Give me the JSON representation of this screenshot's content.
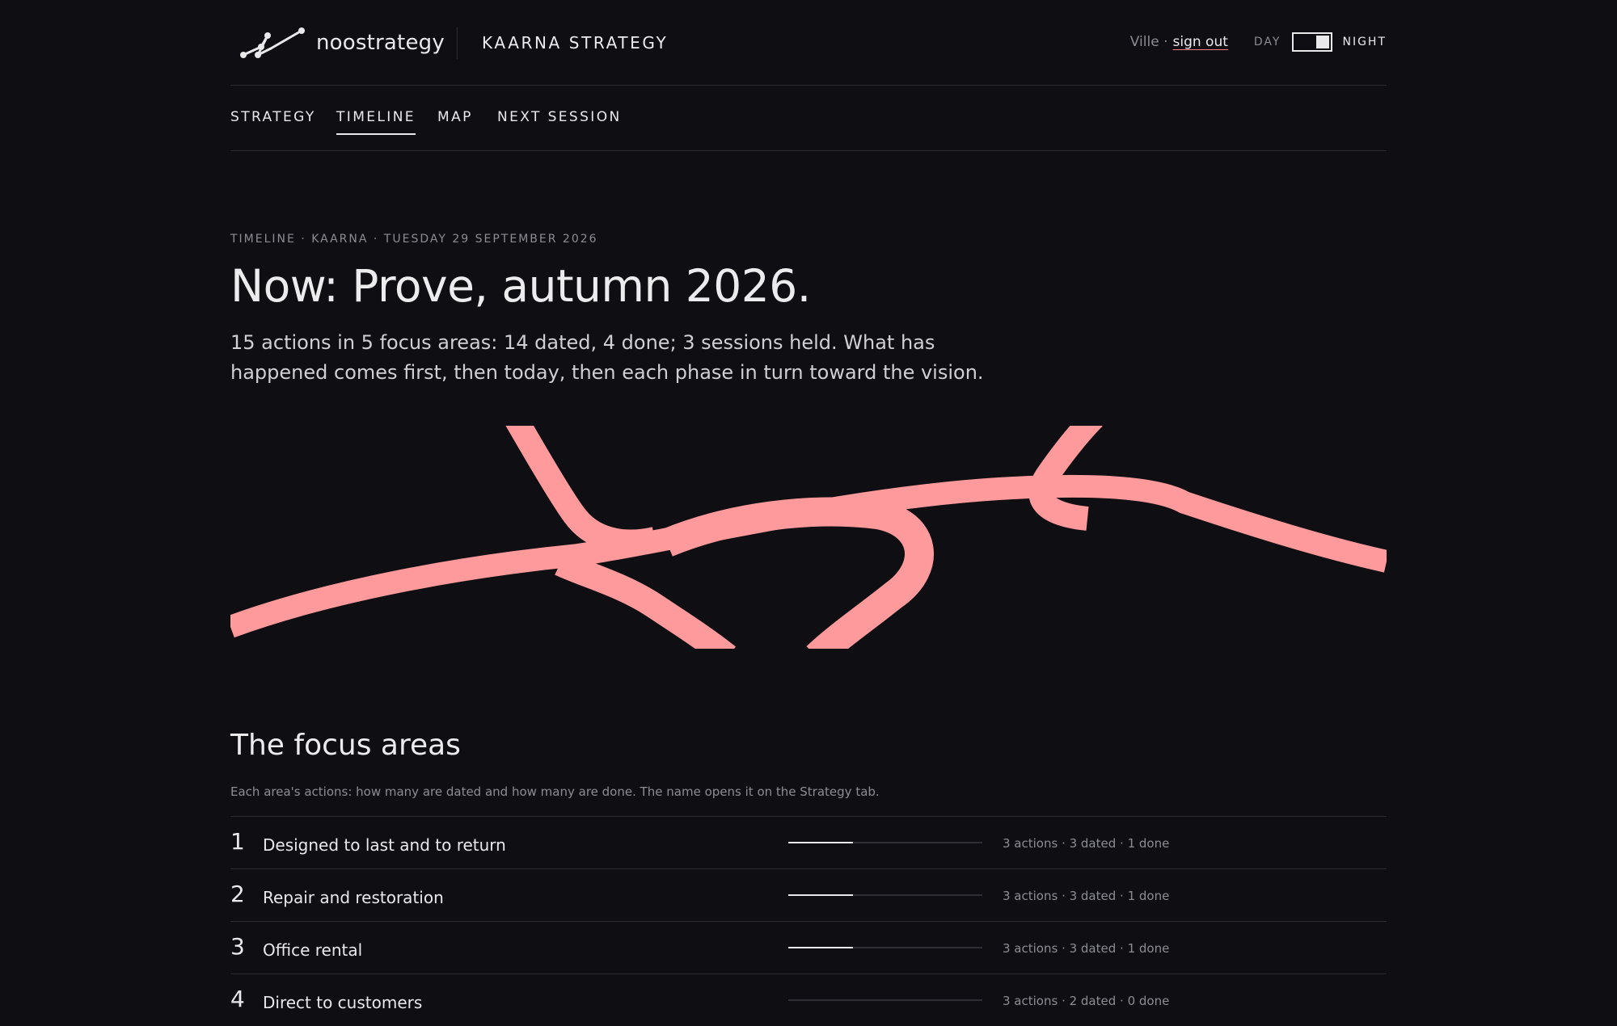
{
  "header": {
    "logo_text": "noostrategy",
    "org_title": "KAARNA STRATEGY",
    "user": "Ville ·",
    "sign_out": "sign out",
    "theme": {
      "day": "DAY",
      "night": "NIGHT",
      "current": "night"
    }
  },
  "tabs": [
    {
      "label": "STRATEGY",
      "active": false
    },
    {
      "label": "TIMELINE",
      "active": true
    },
    {
      "label": "MAP",
      "active": false
    },
    {
      "label": "NEXT SESSION",
      "active": false
    }
  ],
  "hero": {
    "eyebrow": "TIMELINE · KAARNA · TUESDAY 29 SEPTEMBER 2026",
    "title": "Now: Prove, autumn 2026.",
    "summary": "15 actions in 5 focus areas: 14 dated, 4 done; 3 sessions held. What has happened comes first, then today, then each phase in turn toward the vision."
  },
  "colors": {
    "accent": "#ff9a9c",
    "background": "#0f0f13",
    "text": "#e9e9ec",
    "muted": "#8c8c93"
  },
  "focus": {
    "title": "The focus areas",
    "subtitle": "Each area's actions: how many are dated and how many are done. The name opens it on the Strategy tab.",
    "areas": [
      {
        "num": "1",
        "name": "Designed to last and to return",
        "done_fraction": 0.333,
        "stat": "3 actions · 3 dated · 1 done"
      },
      {
        "num": "2",
        "name": "Repair and restoration",
        "done_fraction": 0.333,
        "stat": "3 actions · 3 dated · 1 done"
      },
      {
        "num": "3",
        "name": "Office rental",
        "done_fraction": 0.333,
        "stat": "3 actions · 3 dated · 1 done"
      },
      {
        "num": "4",
        "name": "Direct to customers",
        "done_fraction": 0,
        "stat": "3 actions · 2 dated · 0 done"
      }
    ]
  }
}
